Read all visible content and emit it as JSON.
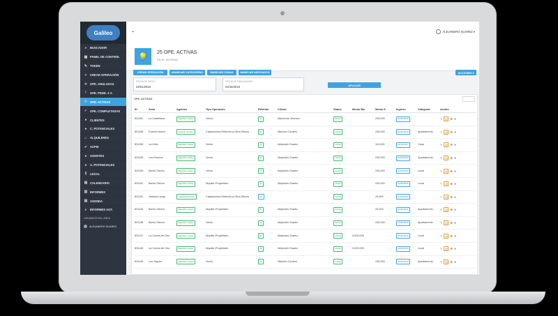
{
  "app": {
    "logo_text": "Galileo"
  },
  "sidebar": {
    "items": [
      {
        "icon": "⌕",
        "label": "BUSCADOR"
      },
      {
        "icon": "▦",
        "label": "PANEL DE CONTROL"
      },
      {
        "icon": "✎",
        "label": "TOKEN"
      },
      {
        "icon": "+",
        "label": "CREAR OPERACIÓN"
      },
      {
        "icon": "✕",
        "label": "OPE. ANULADAS"
      },
      {
        "icon": "!",
        "label": "OPE. PEND. X A"
      },
      {
        "icon": "↻",
        "label": "OPE. ACTIVAS"
      },
      {
        "icon": "✓",
        "label": "OPE. COMPLETADAS"
      },
      {
        "icon": "●",
        "label": "CLIENTES"
      },
      {
        "icon": "●",
        "label": "C. POTENCIALES"
      },
      {
        "icon": "⌂",
        "label": "ALQUILERES"
      },
      {
        "icon": "✔",
        "label": "ACPM"
      },
      {
        "icon": "●",
        "label": "AGENTES"
      },
      {
        "icon": "●",
        "label": "A. POTENCIALES"
      },
      {
        "icon": "§",
        "label": "LEGAL"
      },
      {
        "icon": "▤",
        "label": "CALENDARIO"
      },
      {
        "icon": "▥",
        "label": "INFORMES"
      },
      {
        "icon": "▤",
        "label": "AGENDA"
      },
      {
        "icon": "⌕",
        "label": "INFORMES AGT."
      }
    ],
    "online_label": "USUARIOS EN LÍNEA",
    "online_user": "ALEJANDRO SUAREZ"
  },
  "topbar": {
    "user_name": "ALEJANDRO SUAREZ"
  },
  "header": {
    "title": "25 OPE. ACTIVAS",
    "subtitle": "EN EL SISTEMA"
  },
  "toolbar": {
    "crear": "CREAR OPERACIÓN",
    "categorias": "MANEJAR CATEGORÍAS",
    "zonas": "MANEJAR ZONAS",
    "abogados": "MANEJAR ABOGADOS",
    "acciones": "ACCIONES ▾"
  },
  "filter": {
    "start_label": "FECHA DE INICIO *",
    "start_value": "04/01/2018",
    "end_label": "FECHA DE FINALIZACIÓN *",
    "end_value": "04/16/2018",
    "apply": "APLICAR"
  },
  "table": {
    "title": "OPE. ACTIVAS",
    "columns": [
      "ID",
      "Zona",
      "Agentes",
      "Tipo Operación",
      "Referido",
      "Cliente",
      "Status",
      "Monto Bs/",
      "Monto $",
      "Ingreso",
      "Categoría",
      "Acción"
    ],
    "rows": [
      {
        "id": "831162",
        "zona": "La Castellana",
        "agente": "alejandro suarez",
        "tipo": "Venta",
        "ref": "Si",
        "ref_kind": "s",
        "cliente": "Marianela Jimenez",
        "status": "Activa",
        "bs": "",
        "usd": "230,000",
        "ingreso": "03/20/2018",
        "cat": ""
      },
      {
        "id": "831158",
        "zona": "Pueblo Nuevo",
        "agente": "marcelo cordero",
        "tipo": "Captaciones-Referido-a-Otra-Oficina",
        "ref": "Si",
        "ref_kind": "s",
        "cliente": "Marcelo Cordero",
        "status": "Activa",
        "bs": "",
        "usd": "230,000",
        "ingreso": "03/20/2018",
        "cat": "Apartamento"
      },
      {
        "id": "831156",
        "zona": "La Grita",
        "agente": "alejandro suarez",
        "tipo": "Venta",
        "ref": "Si",
        "ref_kind": "s",
        "cliente": "Alejandro Suarez",
        "status": "Activa",
        "bs": "",
        "usd": "110,000",
        "ingreso": "11/11/2017",
        "cat": "Casa"
      },
      {
        "id": "831155",
        "zona": "Los Kioscos",
        "agente": "alejandro suarez",
        "tipo": "Venta",
        "ref": "Si",
        "ref_kind": "s",
        "cliente": "Alejandro Suarez",
        "status": "Activa",
        "bs": "",
        "usd": "230,000",
        "ingreso": "03/20/2018",
        "cat": "Apartamento"
      },
      {
        "id": "831153",
        "zona": "Barrio Obrero",
        "agente": "alejandro suarez",
        "tipo": "Venta",
        "ref": "Si",
        "ref_kind": "s",
        "cliente": "Alejandro Suarez",
        "status": "Activa",
        "bs": "",
        "usd": "230,000",
        "ingreso": "03/20/2018",
        "cat": "Local"
      },
      {
        "id": "831152",
        "zona": "Barrio Obrero",
        "agente": "alejandro suarez",
        "tipo": "Alquiler-Propietario",
        "ref": "Si",
        "ref_kind": "s",
        "cliente": "Alejandro Suarez",
        "status": "Activa",
        "bs": "",
        "usd": "230,000",
        "ingreso": "03/20/2018",
        "cat": "Local"
      },
      {
        "id": "831151",
        "zona": "Sabana Larga",
        "agente": "marianela jimenez",
        "tipo": "Captaciones-Referido-a-Otra-Oficina",
        "ref": "No",
        "ref_kind": "b",
        "cliente": "",
        "status": "Activa",
        "bs": "",
        "usd": "20,000",
        "ingreso": "03/20/2018",
        "cat": ""
      },
      {
        "id": "831149",
        "zona": "Barrio Obrero",
        "agente": "alejandro suarez",
        "tipo": "Alquiler-Propietario",
        "ref": "Si",
        "ref_kind": "s",
        "cliente": "Alejandro Suarez",
        "status": "Activa",
        "bs": "",
        "usd": "20,000",
        "ingreso": "03/20/2018",
        "cat": "Apartamento"
      },
      {
        "id": "831148",
        "zona": "Barrio Obrero",
        "agente": "alejandro suarez",
        "tipo": "Venta",
        "ref": "Si",
        "ref_kind": "s",
        "cliente": "Alejandro Suarez",
        "status": "Activa",
        "bs": "",
        "usd": "230,000",
        "ingreso": "03/20/2018",
        "cat": "Apartamento"
      },
      {
        "id": "831147",
        "zona": "La Cueva del Oso",
        "agente": "alejandro suarez",
        "tipo": "Alquiler-Propietario",
        "ref": "Si",
        "ref_kind": "s",
        "cliente": "Alejandro Suarez",
        "status": "Activa",
        "bs": "3.000,000",
        "usd": "",
        "ingreso": "03/20/2018",
        "cat": "Local"
      },
      {
        "id": "831146",
        "zona": "La Cueva del Oso",
        "agente": "alejandro suarez",
        "tipo": "Alquiler-Propietario",
        "ref": "Si",
        "ref_kind": "s",
        "cliente": "Alejandro Suarez",
        "status": "Activa",
        "bs": "3.000,000",
        "usd": "",
        "ingreso": "03/20/2018",
        "cat": "Local"
      },
      {
        "id": "831145",
        "zona": "Los Teques",
        "agente": "alejandro suarez",
        "tipo": "Venta",
        "ref": "Si",
        "ref_kind": "s",
        "cliente": "Marcelo Cordero",
        "status": "Activa",
        "bs": "",
        "usd": "230,000",
        "ingreso": "03/20/2018",
        "cat": "Apartamento"
      }
    ]
  }
}
